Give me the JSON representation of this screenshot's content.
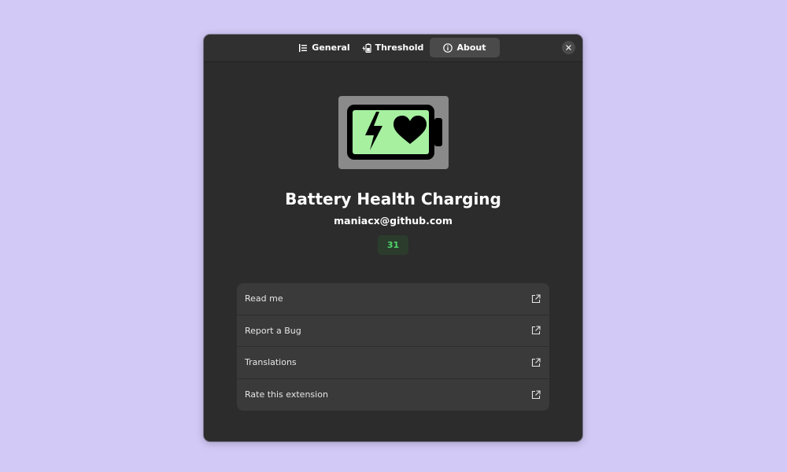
{
  "tabs": [
    {
      "label": "General",
      "icon": "list-icon"
    },
    {
      "label": "Threshold",
      "icon": "battery-charge-icon"
    },
    {
      "label": "About",
      "icon": "info-icon",
      "active": true
    }
  ],
  "about": {
    "app_name": "Battery Health Charging",
    "developer": "maniacx@github.com",
    "version": "31"
  },
  "links": [
    {
      "label": "Read me",
      "icon": "external-link-icon"
    },
    {
      "label": "Report a Bug",
      "icon": "external-link-icon"
    },
    {
      "label": "Translations",
      "icon": "external-link-icon"
    },
    {
      "label": "Rate this extension",
      "icon": "external-link-icon"
    }
  ],
  "colors": {
    "background": "#d2c9f6",
    "window": "#2c2c2c",
    "accent_green": "#4fd46a",
    "logo_fill": "#a6f0a0"
  }
}
